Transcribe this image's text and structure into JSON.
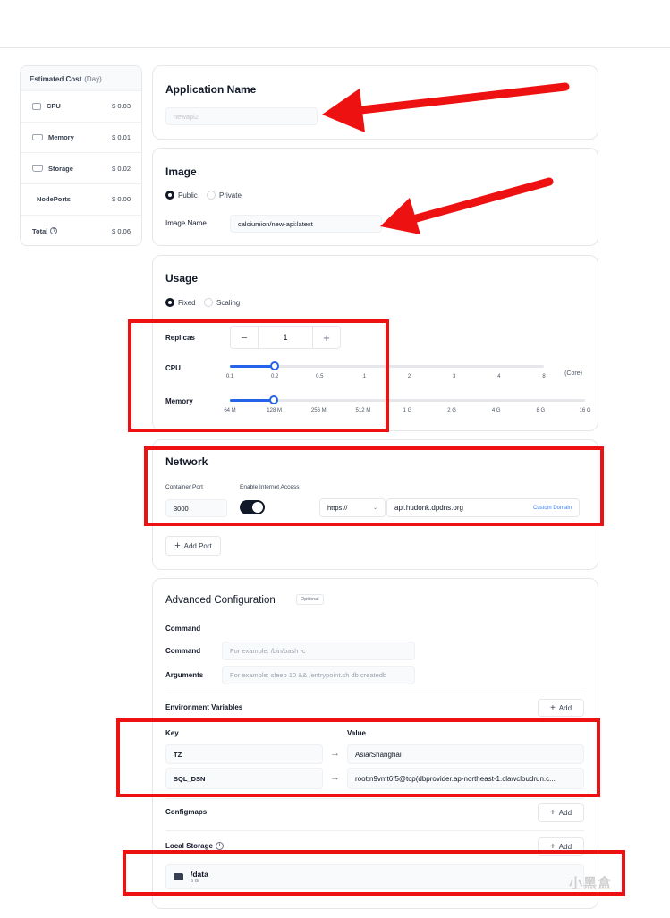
{
  "cost": {
    "title": "Estimated Cost",
    "period": "(Day)",
    "rows": [
      {
        "label": "CPU",
        "value": "$ 0.03",
        "icon": "cpu-icon"
      },
      {
        "label": "Memory",
        "value": "$ 0.01",
        "icon": "memory-icon"
      },
      {
        "label": "Storage",
        "value": "$ 0.02",
        "icon": "storage-icon"
      },
      {
        "label": "NodePorts",
        "value": "$ 0.00",
        "icon": ""
      },
      {
        "label": "Total",
        "value": "$ 0.06",
        "icon": "help-icon"
      }
    ]
  },
  "app": {
    "title": "Application Name",
    "name_value": "newapi2"
  },
  "image": {
    "title": "Image",
    "public_label": "Public",
    "private_label": "Private",
    "selected": "Public",
    "image_name_label": "Image Name",
    "image_name_value": "calciumion/new-api:latest"
  },
  "usage": {
    "title": "Usage",
    "fixed_label": "Fixed",
    "scaling_label": "Scaling",
    "selected": "Fixed",
    "replicas_label": "Replicas",
    "replicas_value": "1",
    "minus": "−",
    "plus": "+",
    "cpu_label": "CPU",
    "cpu_ticks": [
      "0.1",
      "0.2",
      "0.5",
      "1",
      "2",
      "3",
      "4",
      "8"
    ],
    "cpu_selected": "0.2",
    "cpu_unit": "(Core)",
    "memory_label": "Memory",
    "memory_ticks": [
      "64 M",
      "128 M",
      "256 M",
      "512 M",
      "1 G",
      "2 G",
      "4 G",
      "8 G",
      "16 G"
    ],
    "memory_selected": "128 M"
  },
  "network": {
    "title": "Network",
    "port_label": "Container Port",
    "port_value": "3000",
    "internet_label": "Enable Internet Access",
    "internet_enabled": true,
    "protocol_value": "https://",
    "domain_value": "api.hudonk.dpdns.org",
    "custom_domain": "Custom Domain",
    "add_port": "Add Port"
  },
  "advanced": {
    "title": "Advanced Configuration",
    "optional": "Optional",
    "command_section": "Command",
    "command_label": "Command",
    "command_placeholder": "For example: /bin/bash -c",
    "arguments_label": "Arguments",
    "arguments_placeholder": "For example: sleep 10 && /entrypoint.sh db createdb",
    "env_title": "Environment Variables",
    "add": "Add",
    "key_header": "Key",
    "value_header": "Value",
    "env": [
      {
        "key": "TZ",
        "value": "Asia/Shanghai"
      },
      {
        "key": "SQL_DSN",
        "value": "root:n9vmt6f5@tcp(dbprovider.ap-northeast-1.clawcloudrun.c..."
      }
    ],
    "configmaps_title": "Configmaps",
    "local_storage_title": "Local Storage",
    "storage_path": "/data",
    "storage_size": "5 Gi"
  },
  "watermark": "小黑盒",
  "colors": {
    "accent": "#2563eb",
    "annotation": "#ee1111",
    "toggle_on": "#111827"
  }
}
